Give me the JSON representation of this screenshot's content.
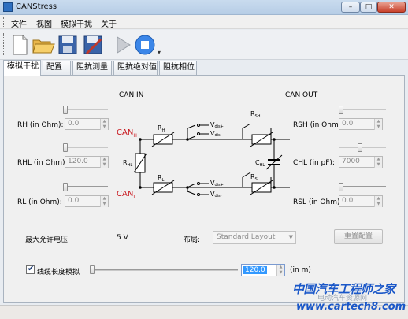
{
  "window": {
    "title": "CANStress",
    "min": "–",
    "max": "□",
    "close": "✕"
  },
  "menu": [
    "文件",
    "视图",
    "模拟干扰",
    "关于"
  ],
  "toolbar": [
    "new-icon",
    "open-icon",
    "save-icon",
    "edit-icon",
    "play-icon",
    "stop-icon"
  ],
  "tabs": [
    "模拟干扰",
    "配置",
    "阻抗测量",
    "阻抗绝对值",
    "阻抗相位"
  ],
  "panel": {
    "can_in": "CAN IN",
    "can_out": "CAN OUT",
    "left_params": [
      {
        "label": "RH (in Ohm):",
        "value": "0.0",
        "slider_level": 0.0
      },
      {
        "label": "RHL (in Ohm):",
        "value": "120.0",
        "slider_level": 0.0
      },
      {
        "label": "RL (in Ohm):",
        "value": "0.0",
        "slider_level": 0.0
      }
    ],
    "right_params": [
      {
        "label": "RSH (in Ohm):",
        "value": "0.0",
        "slider_level": 0.0
      },
      {
        "label": "CHL (in pF):",
        "value": "7000",
        "slider_level": 0.45
      },
      {
        "label": "RSL (in Ohm):",
        "value": "0.0",
        "slider_level": 0.0
      }
    ],
    "circuit": {
      "can_h": "CAN",
      "can_h_sub": "H",
      "can_l": "CAN",
      "can_l_sub": "L",
      "rh": "R",
      "rh_sub": "H",
      "rl": "R",
      "rl_sub": "L",
      "rhl": "R",
      "rhl_sub": "HL",
      "rsh": "R",
      "rsh_sub": "SH",
      "rsl": "R",
      "rsl_sub": "SL",
      "chl": "C",
      "chl_sub": "HL",
      "vdis_plus_top": "V",
      "vdis_plus_top_sub": "dis+",
      "vdis_minus_top": "V",
      "vdis_minus_top_sub": "dis-",
      "vdis_plus_bot": "V",
      "vdis_plus_bot_sub": "dis+",
      "vdis_minus_bot": "V",
      "vdis_minus_bot_sub": "dis-"
    },
    "max_voltage_label": "最大允许电压:",
    "max_voltage_value": "5 V",
    "layout_label": "布局:",
    "layout_value": "Standard Layout",
    "reset_button": "重置配置",
    "cable_label": "线缆长度模拟",
    "cable_checked": true,
    "cable_value": "120.0",
    "cable_unit": "(in m)"
  },
  "watermark": {
    "main": "中国汽车工程师之家",
    "sub": "电动汽车资源网",
    "url": "www.cartech8.com"
  },
  "colors": {
    "can_red": "#c8161d",
    "link_blue": "#1a57c8"
  }
}
